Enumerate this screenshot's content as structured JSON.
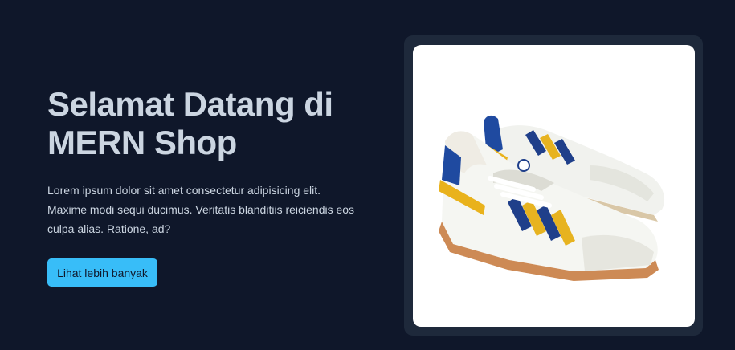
{
  "hero": {
    "title": "Selamat Datang di MERN Shop",
    "description": "Lorem ipsum dolor sit amet consectetur adipisicing elit. Maxime modi sequi ducimus. Veritatis blanditiis reiciendis eos culpa alias. Ratione, ad?",
    "cta_label": "Lihat lebih banyak",
    "image_subject": "sneakers-pair"
  },
  "colors": {
    "background": "#0f172a",
    "card": "#1e293b",
    "text": "#cbd5e1",
    "accent": "#38bdf8"
  }
}
